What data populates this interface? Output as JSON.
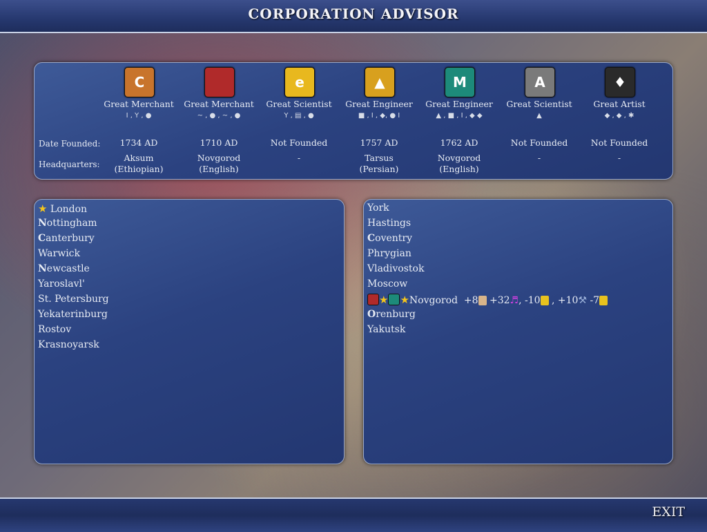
{
  "header": {
    "title": "CORPORATION ADVISOR"
  },
  "footer": {
    "exit_label": "EXIT"
  },
  "row_labels": {
    "founded": "Date Founded:",
    "hq": "Headquarters:"
  },
  "corporations": [
    {
      "logo_icon": "cereal-mills-icon",
      "logo_letter": "C",
      "color": "#c8742c",
      "founder": "Great Merchant",
      "resources": "I , Y , ●",
      "founded": "1734 AD",
      "hq_city": "Aksum",
      "hq_civ": "(Ethiopian)"
    },
    {
      "logo_icon": "sushi-co-icon",
      "logo_letter": "",
      "color": "#b02a2a",
      "founder": "Great Merchant",
      "resources": "~ , ● , ~ , ●",
      "founded": "1710 AD",
      "hq_city": "Novgorod",
      "hq_civ": "(English)"
    },
    {
      "logo_icon": "enterprise-icon",
      "logo_letter": "e",
      "color": "#e8b81e",
      "founder": "Great Scientist",
      "resources": "Y , ▤ , ●",
      "founded": "Not Founded",
      "hq_city": "-",
      "hq_civ": ""
    },
    {
      "logo_icon": "creative-constructions-icon",
      "logo_letter": "▲",
      "color": "#d8a01e",
      "founder": "Great Engineer",
      "resources": "■ , I , ◆, ● I",
      "founded": "1757 AD",
      "hq_city": "Tarsus",
      "hq_civ": "(Persian)"
    },
    {
      "logo_icon": "mining-inc-icon",
      "logo_letter": "M",
      "color": "#1d8a7a",
      "founder": "Great Engineer",
      "resources": "▲ , ■ , I , ◆ ◆",
      "founded": "1762 AD",
      "hq_city": "Novgorod",
      "hq_civ": "(English)"
    },
    {
      "logo_icon": "aluminum-co-icon",
      "logo_letter": "A",
      "color": "#7a7a7a",
      "founder": "Great Scientist",
      "resources": "▲",
      "founded": "Not Founded",
      "hq_city": "-",
      "hq_civ": ""
    },
    {
      "logo_icon": "civilized-jewelers-icon",
      "logo_letter": "♦",
      "color": "#2a2a2a",
      "founder": "Great Artist",
      "resources": "◆ , ◆ , ✱",
      "founded": "Not Founded",
      "hq_city": "-",
      "hq_civ": ""
    }
  ],
  "left_cities": [
    {
      "first": "",
      "rest": "London",
      "capital": true
    },
    {
      "first": "N",
      "rest": "ottingham"
    },
    {
      "first": "C",
      "rest": "anterbury"
    },
    {
      "first": "",
      "rest": "Warwick"
    },
    {
      "first": "N",
      "rest": "ewcastle"
    },
    {
      "first": "",
      "rest": "Yaroslavl'"
    },
    {
      "first": "",
      "rest": "St. Petersburg"
    },
    {
      "first": "",
      "rest": "Yekaterinburg"
    },
    {
      "first": "",
      "rest": "Rostov"
    },
    {
      "first": "",
      "rest": "Krasnoyarsk"
    }
  ],
  "right_cities": [
    {
      "first": "",
      "rest": "York"
    },
    {
      "first": "",
      "rest": "Hastings"
    },
    {
      "first": "C",
      "rest": "oventry"
    },
    {
      "first": "",
      "rest": "Phrygian"
    },
    {
      "first": "",
      "rest": "Vladivostok"
    },
    {
      "first": "",
      "rest": "Moscow"
    },
    {
      "first": "",
      "rest": "Novgorod",
      "hq": true
    },
    {
      "first": "O",
      "rest": "renburg"
    },
    {
      "first": "",
      "rest": "Yakutsk"
    }
  ],
  "novgorod_yields": {
    "research": "+8",
    "culture": "+32",
    "gold_a": ", -10",
    "hammers": ", +10",
    "gold_b": "-7"
  },
  "colors": {
    "panel": "#2b4280",
    "star": "#f4c51c",
    "bar": "#26386f"
  }
}
